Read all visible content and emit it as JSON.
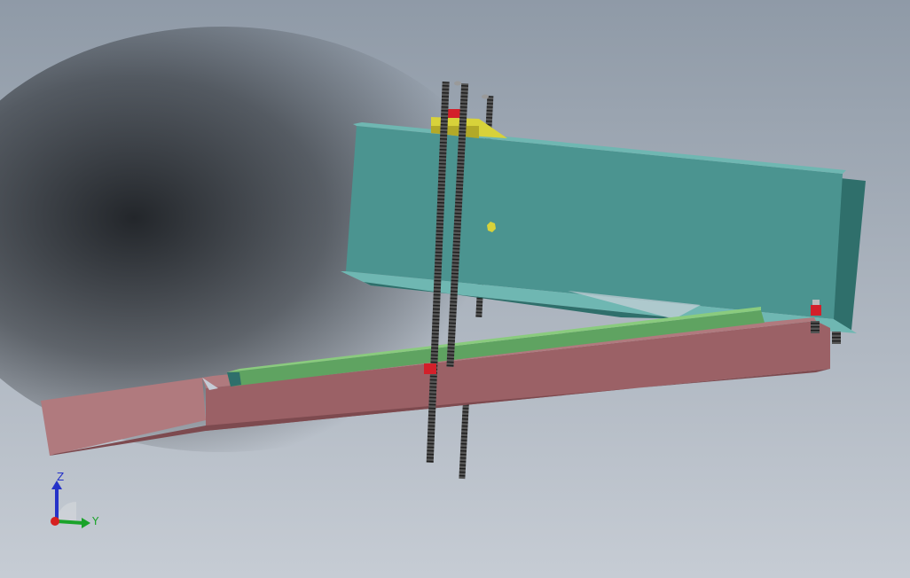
{
  "view": {
    "background_top": "#8f9aa7",
    "background_bottom": "#c6ccd4",
    "shadow_color": "#1c1f23"
  },
  "model": {
    "colors": {
      "beam": "#4b9490",
      "beam_light": "#6fb7b2",
      "beam_dark": "#2f6f6b",
      "base": "#9b6166",
      "base_light": "#b07a7e",
      "base_dark": "#7d4a4f",
      "rail": "#5fa361",
      "rail_light": "#8acb7e",
      "clamp": "#d8d23a",
      "clamp_dark": "#b2a928",
      "rod": "#3b3b3b",
      "nut": "#d3202a"
    }
  },
  "triad": {
    "x_color": "#d62020",
    "y_color": "#1aa32a",
    "z_color": "#2532c8",
    "z_label": "Z",
    "y_label": "Y"
  }
}
